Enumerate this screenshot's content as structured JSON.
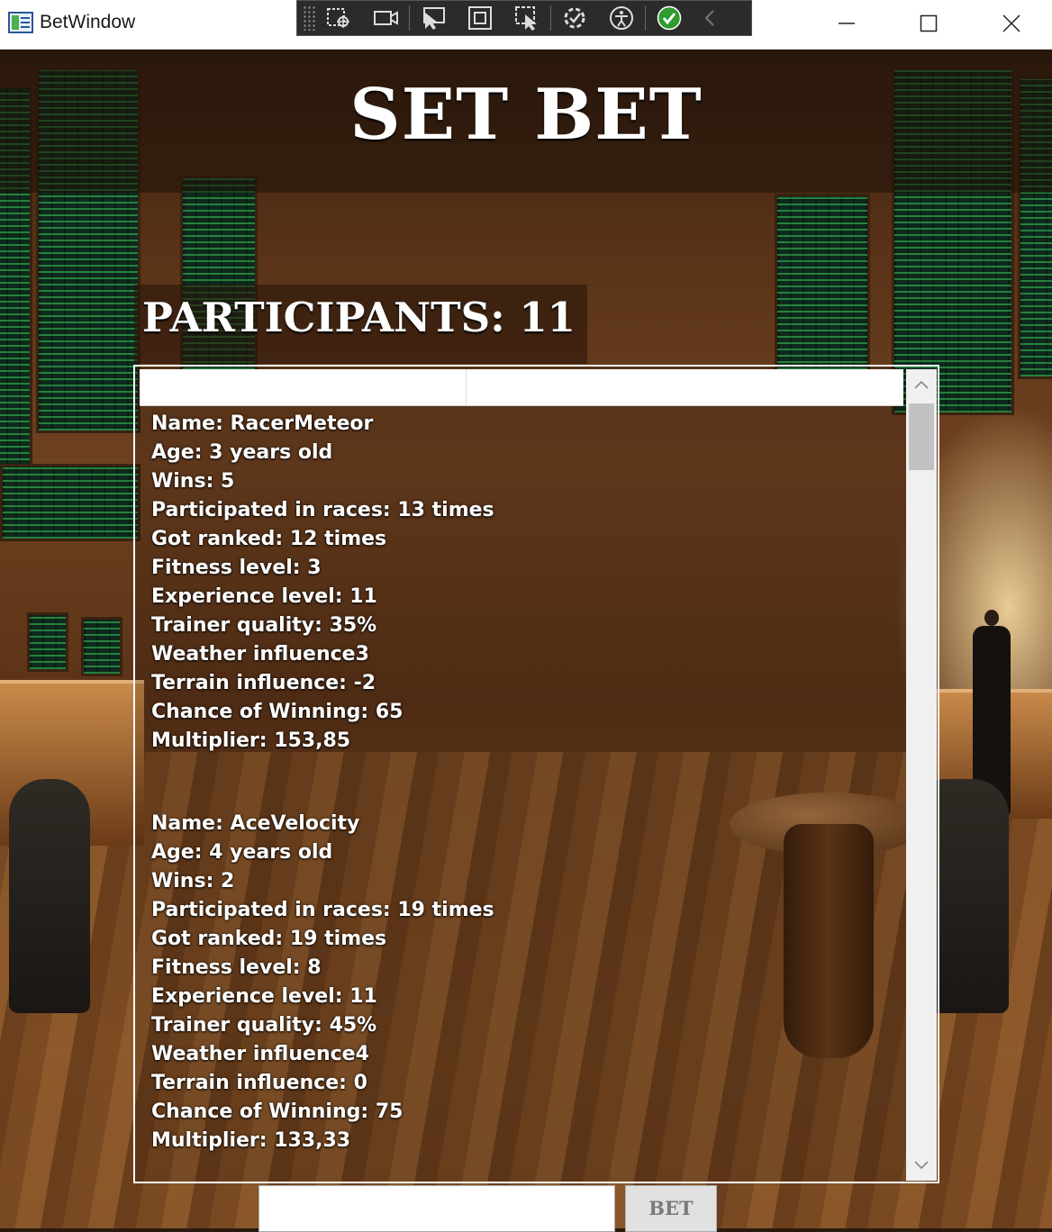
{
  "window": {
    "title": "BetWindow"
  },
  "header": {
    "title": "SET BET"
  },
  "participants": {
    "label": "PARTICIPANTS: 11"
  },
  "bet": {
    "input_value": "",
    "button_label": "BET"
  },
  "horses": [
    {
      "name": "Name: RacerMeteor",
      "age": "Age: 3 years old",
      "wins": "Wins: 5",
      "races": "Participated in races: 13 times",
      "ranked": "Got ranked: 12 times",
      "fitness": "Fitness level: 3",
      "experience": "Experience level: 11",
      "trainer": "Trainer quality: 35%",
      "weather": "Weather influence3",
      "terrain": "Terrain influence: -2",
      "chance": "Chance of Winning: 65",
      "multiplier": "Multiplier: 153,85"
    },
    {
      "name": "Name: AceVelocity",
      "age": "Age: 4 years old",
      "wins": "Wins: 2",
      "races": "Participated in races: 19 times",
      "ranked": "Got ranked: 19 times",
      "fitness": "Fitness level: 8",
      "experience": "Experience level: 11",
      "trainer": "Trainer quality: 45%",
      "weather": "Weather influence4",
      "terrain": "Terrain influence: 0",
      "chance": "Chance of Winning: 75",
      "multiplier": "Multiplier: 133,33"
    }
  ],
  "icons": {
    "app": "window-app-icon",
    "toolbar": [
      "select-element-icon",
      "video-icon",
      "pointer-select-icon",
      "layout-adorner-icon",
      "track-focus-icon",
      "binding-failures-icon",
      "accessibility-icon",
      "check-icon",
      "collapse-chevron-icon"
    ],
    "minimize": "minimize-icon",
    "maximize": "maximize-icon",
    "close": "close-icon"
  },
  "colors": {
    "title_text": "#ffffff",
    "list_text": "#ffffff",
    "check_green": "#2e9b2e"
  }
}
